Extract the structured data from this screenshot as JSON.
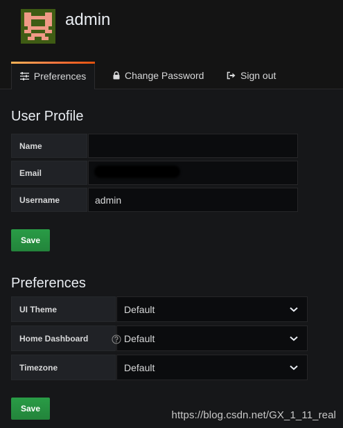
{
  "user": {
    "name": "admin"
  },
  "tabs": [
    {
      "label": "Preferences",
      "icon": "sliders-icon",
      "active": true
    },
    {
      "label": "Change Password",
      "icon": "lock-icon",
      "active": false
    },
    {
      "label": "Sign out",
      "icon": "sign-out-icon",
      "active": false
    }
  ],
  "profile": {
    "title": "User Profile",
    "fields": {
      "name": {
        "label": "Name",
        "value": ""
      },
      "email": {
        "label": "Email",
        "value": ""
      },
      "username": {
        "label": "Username",
        "value": "admin"
      }
    },
    "save_label": "Save"
  },
  "preferences": {
    "title": "Preferences",
    "ui_theme": {
      "label": "UI Theme",
      "value": "Default"
    },
    "home_dashboard": {
      "label": "Home Dashboard",
      "value": "Default"
    },
    "timezone": {
      "label": "Timezone",
      "value": "Default"
    },
    "save_label": "Save"
  },
  "watermark": "https://blog.csdn.net/GX_1_11_real",
  "colors": {
    "background": "#161719",
    "header": "#141414",
    "label_bg": "#202226",
    "input_bg": "#0b0c0e",
    "save_green": "#299c46",
    "tab_accent": "#ff7941"
  }
}
